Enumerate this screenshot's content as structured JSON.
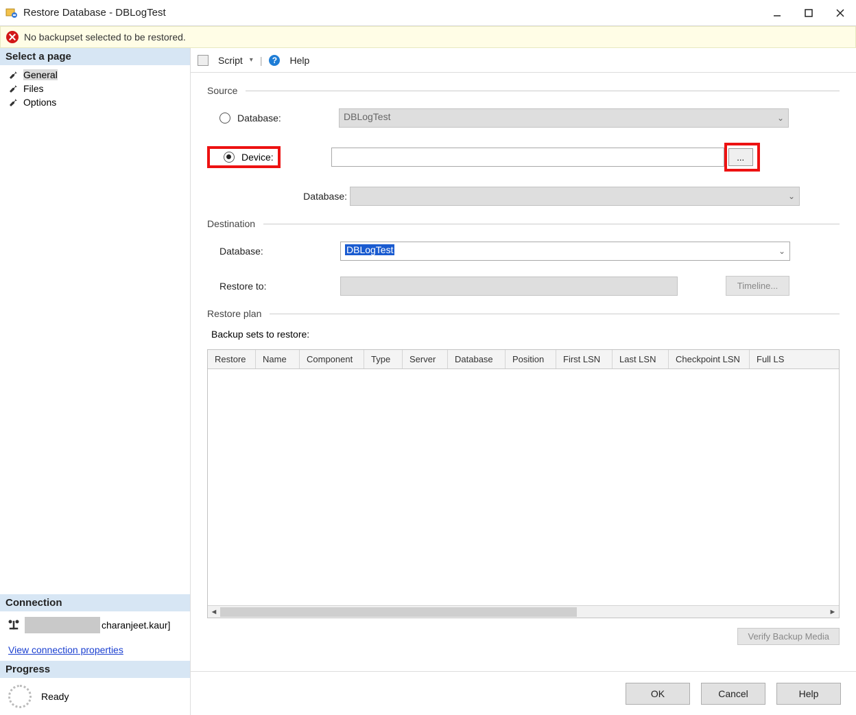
{
  "window": {
    "title": "Restore Database - DBLogTest"
  },
  "alert": {
    "message": "No backupset selected to be restored."
  },
  "sidebar": {
    "heading_select_page": "Select a page",
    "pages": [
      "General",
      "Files",
      "Options"
    ],
    "heading_connection": "Connection",
    "connection_user_suffix": "charanjeet.kaur]",
    "view_properties": "View connection properties",
    "heading_progress": "Progress",
    "progress_status": "Ready"
  },
  "toolbar": {
    "script": "Script",
    "dropdown": "▾",
    "separator": "|",
    "help": "Help"
  },
  "source": {
    "heading": "Source",
    "database_label": "Database:",
    "database_value": "DBLogTest",
    "device_label": "Device:",
    "device_value": "",
    "device_db_label": "Database:",
    "device_db_value": "",
    "browse_label": "..."
  },
  "destination": {
    "heading": "Destination",
    "database_label": "Database:",
    "database_value": "DBLogTest",
    "restore_to_label": "Restore to:",
    "restore_to_value": "",
    "timeline_label": "Timeline..."
  },
  "restore_plan": {
    "heading": "Restore plan",
    "sets_label": "Backup sets to restore:",
    "columns": [
      "Restore",
      "Name",
      "Component",
      "Type",
      "Server",
      "Database",
      "Position",
      "First LSN",
      "Last LSN",
      "Checkpoint LSN",
      "Full LS"
    ],
    "verify_label": "Verify Backup Media"
  },
  "footer": {
    "ok": "OK",
    "cancel": "Cancel",
    "help": "Help"
  }
}
